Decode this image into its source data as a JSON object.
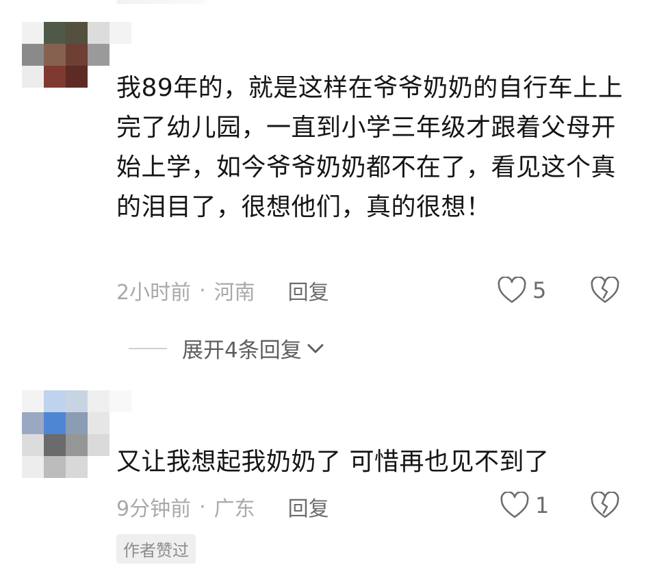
{
  "comments": [
    {
      "text": "我89年的，就是这样在爷爷奶奶的自行车上上完了幼儿园，一直到小学三年级才跟着父母开始上学，如今爷爷奶奶都不在了，看见这个真的泪目了，很想他们，真的很想！",
      "time": "2小时前",
      "separator": "·",
      "location": "河南",
      "reply_label": "回复",
      "like_count": "5",
      "expand_label": "展开4条回复"
    },
    {
      "text": "又让我想起我奶奶了  可惜再也见不到了",
      "time": "9分钟前",
      "separator": "·",
      "location": "广东",
      "reply_label": "回复",
      "like_count": "1",
      "badge": "作者赞过"
    }
  ],
  "icons": {
    "like": "heart-outline-icon",
    "dislike": "broken-heart-icon",
    "expand": "chevron-down-icon"
  },
  "colors": {
    "text": "#151515",
    "meta": "#a9a9a9",
    "action": "#6c6c6c",
    "badge_bg": "#efefef"
  },
  "avatar_1_pixels": [
    "#f1f1f1",
    "#4e5a47",
    "#53503e",
    "#dcdcdc",
    "#f3f3f3",
    "#8a8a8a",
    "#866150",
    "#6d3f35",
    "#9a9a9a",
    "#ffffff",
    "#ececec",
    "#7e3a2e",
    "#5e2a25",
    "#ffffff",
    "#ffffff"
  ],
  "avatar_2_pixels": [
    "#f3f3f3",
    "#bfd3ee",
    "#c9d4e2",
    "#efefef",
    "#f8f8f8",
    "#9aa8c1",
    "#4f86d4",
    "#8b9cb5",
    "#e6e6e6",
    "#ffffff",
    "#dcdcdc",
    "#6b6b6b",
    "#969696",
    "#dadada",
    "#ffffff",
    "#ededed",
    "#bcbcbc",
    "#d8d8d8",
    "#ffffff",
    "#ffffff"
  ]
}
